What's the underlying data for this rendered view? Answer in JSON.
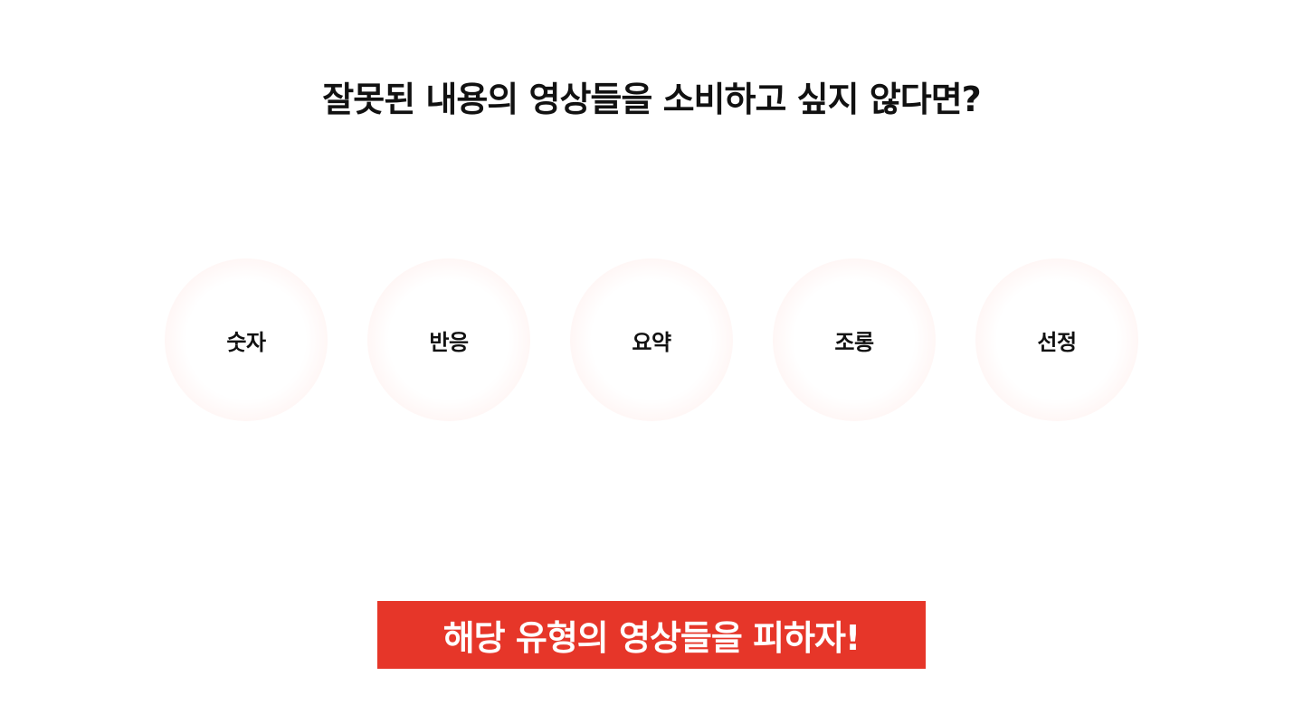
{
  "heading": {
    "text": "잘못된 내용의 영상들을 소비하고 싶지 않다면?"
  },
  "categories": [
    {
      "label": "숫자"
    },
    {
      "label": "반응"
    },
    {
      "label": "요약"
    },
    {
      "label": "조롱"
    },
    {
      "label": "선정"
    }
  ],
  "cta": {
    "text": "해당 유형의 영상들을 피하자!",
    "background_color": "#e63629",
    "text_color": "#ffffff"
  },
  "colors": {
    "circle_tint": "#ffecea",
    "text": "#111111",
    "background": "#ffffff"
  }
}
